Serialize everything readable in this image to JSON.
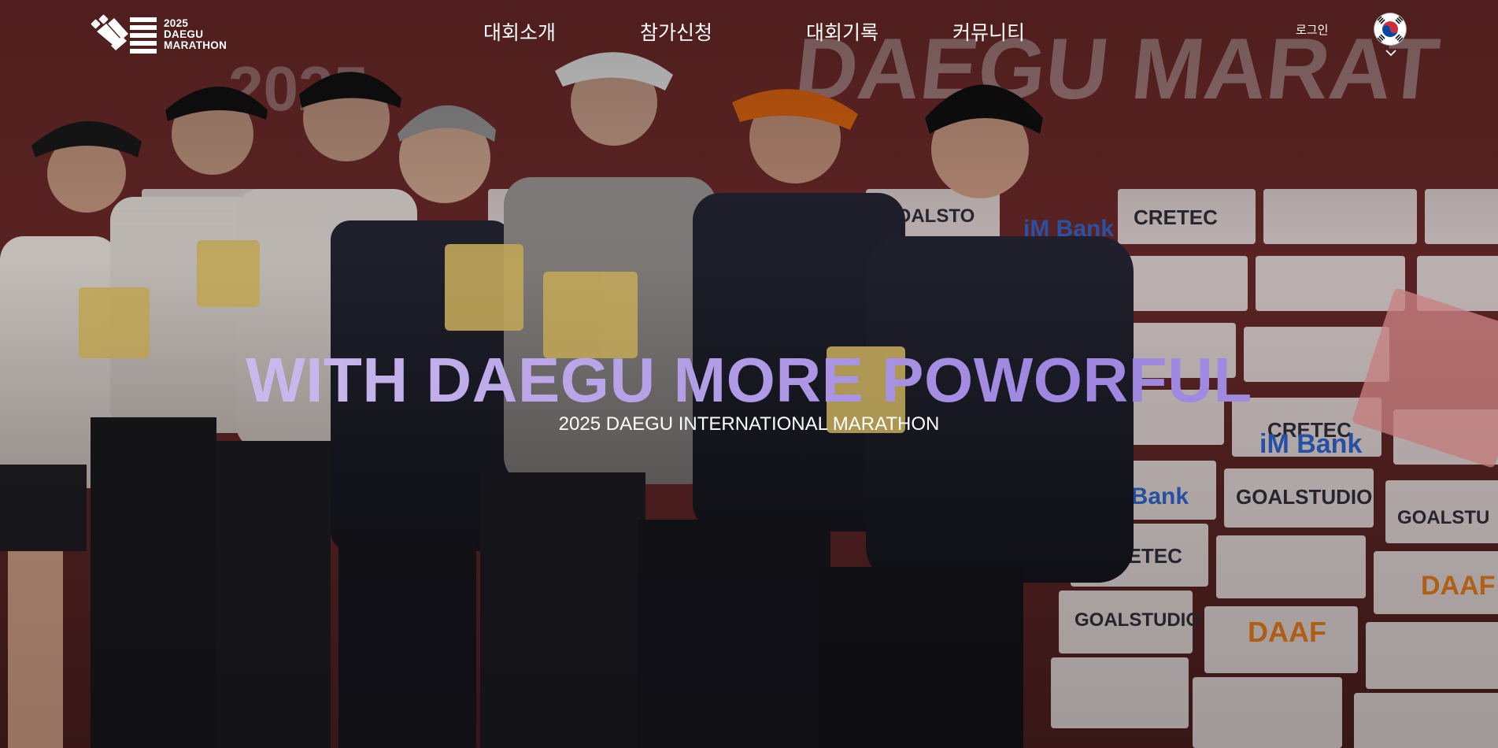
{
  "header": {
    "logo": {
      "line1": "2025",
      "line2": "DAEGU",
      "line3": "MARATHON"
    },
    "nav": [
      {
        "label": "대회소개"
      },
      {
        "label": "참가신청"
      },
      {
        "label": "대회기록"
      },
      {
        "label": "커뮤니티"
      }
    ],
    "login_label": "로그인",
    "language_icon": "korea-flag-icon"
  },
  "hero": {
    "headline": "WITH DAEGU MORE POWORFUL",
    "subline": "2025 DAEGU INTERNATIONAL MARATHON",
    "background_image": "award-ceremony-photo",
    "backdrop_text": "DAEGU MARAT",
    "sponsors": [
      "CRETEC",
      "GOALSTUDIO",
      "iM Bank",
      "DAAF"
    ]
  },
  "colors": {
    "headline_gradient_start": "#d8c8ef",
    "headline_gradient_end": "#9e87e0",
    "nav_text": "#ffffff"
  }
}
